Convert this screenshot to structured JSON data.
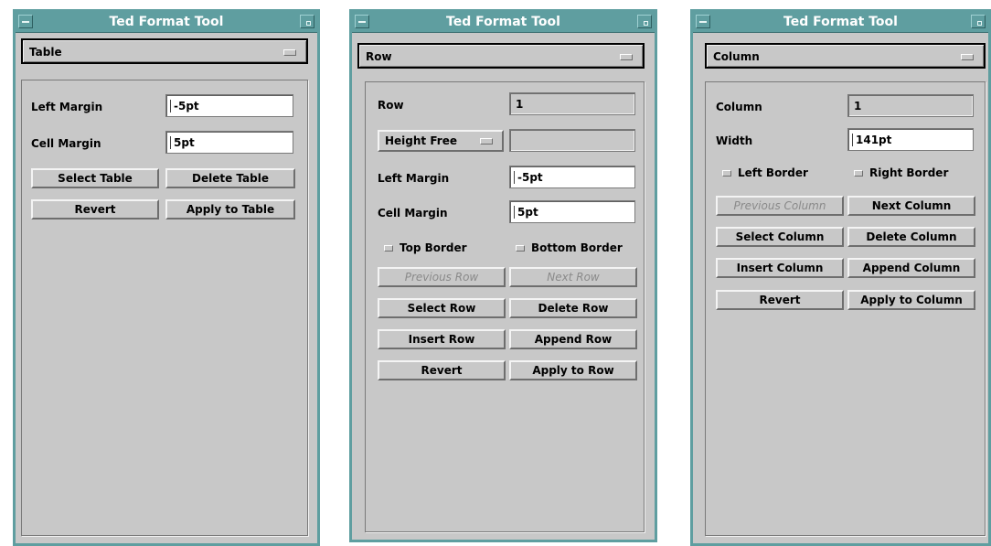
{
  "colors": {
    "title_bar": "#5f9ea0",
    "window_bg": "#c8c8c8"
  },
  "table_window": {
    "title": "Ted Format Tool",
    "selector": "Table",
    "left_margin_label": "Left Margin",
    "left_margin_value": "-5pt",
    "cell_margin_label": "Cell Margin",
    "cell_margin_value": "5pt",
    "select_table": "Select Table",
    "delete_table": "Delete Table",
    "revert": "Revert",
    "apply": "Apply to Table"
  },
  "row_window": {
    "title": "Ted Format Tool",
    "selector": "Row",
    "row_label": "Row",
    "row_value": "1",
    "height_mode": "Height Free",
    "height_value": "",
    "left_margin_label": "Left Margin",
    "left_margin_value": "-5pt",
    "cell_margin_label": "Cell Margin",
    "cell_margin_value": "5pt",
    "top_border": "Top Border",
    "bottom_border": "Bottom Border",
    "previous_row": "Previous Row",
    "next_row": "Next Row",
    "select_row": "Select Row",
    "delete_row": "Delete Row",
    "insert_row": "Insert Row",
    "append_row": "Append Row",
    "revert": "Revert",
    "apply": "Apply to Row"
  },
  "column_window": {
    "title": "Ted Format Tool",
    "selector": "Column",
    "column_label": "Column",
    "column_value": "1",
    "width_label": "Width",
    "width_value": "141pt",
    "left_border": "Left Border",
    "right_border": "Right Border",
    "previous_column": "Previous Column",
    "next_column": "Next Column",
    "select_column": "Select Column",
    "delete_column": "Delete Column",
    "insert_column": "Insert Column",
    "append_column": "Append Column",
    "revert": "Revert",
    "apply": "Apply to Column"
  }
}
